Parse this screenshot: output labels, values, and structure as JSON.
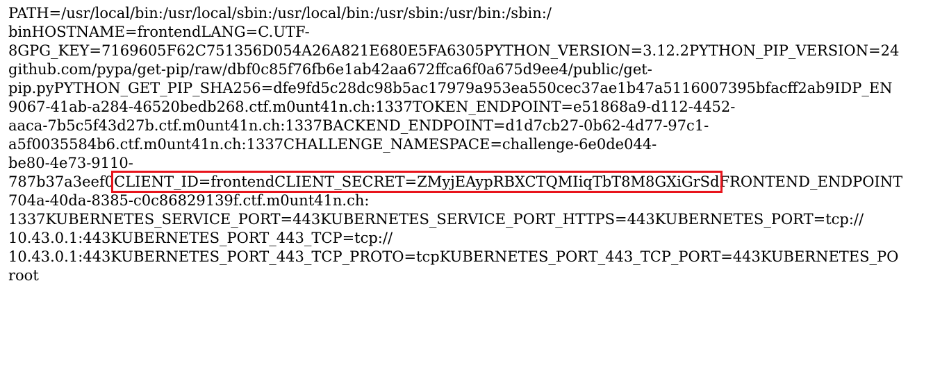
{
  "env_output": {
    "lines": [
      "PATH=/usr/local/bin:/usr/local/sbin:/usr/local/bin:/usr/sbin:/usr/bin:/sbin:/",
      "binHOSTNAME=frontendLANG=C.UTF-",
      "8GPG_KEY=7169605F62C751356D054A26A821E680E5FA6305PYTHON_VERSION=3.12.2PYTHON_PIP_VERSION=24",
      "github.com/pypa/get-pip/raw/dbf0c85f76fb6e1ab42aa672ffca6f0a675d9ee4/public/get-",
      "pip.pyPYTHON_GET_PIP_SHA256=dfe9fd5c28dc98b5ac17979a953ea550cec37ae1b47a5116007395bfacff2ab9IDP_EN",
      "9067-41ab-a284-46520bedb268.ctf.m0unt41n.ch:1337TOKEN_ENDPOINT=e51868a9-d112-4452-",
      "aaca-7b5c5f43d27b.ctf.m0unt41n.ch:1337BACKEND_ENDPOINT=d1d7cb27-0b62-4d77-97c1-",
      "a5f0035584b6.ctf.m0unt41n.ch:1337CHALLENGE_NAMESPACE=challenge-6e0de044-",
      "be80-4e73-9110-"
    ],
    "highlight_line": {
      "prefix": "787b37a3eef0",
      "highlighted": "CLIENT_ID=frontendCLIENT_SECRET=ZMyjEAypRBXCTQMIiqTbT8M8GXiGrSd",
      "suffix": "FRONTEND_ENDPOINT"
    },
    "lines_after": [
      "704a-40da-8385-c0c86829139f.ctf.m0unt41n.ch:",
      "1337KUBERNETES_SERVICE_PORT=443KUBERNETES_SERVICE_PORT_HTTPS=443KUBERNETES_PORT=tcp://",
      "10.43.0.1:443KUBERNETES_PORT_443_TCP=tcp://",
      "10.43.0.1:443KUBERNETES_PORT_443_TCP_PROTO=tcpKUBERNETES_PORT_443_TCP_PORT=443KUBERNETES_PO",
      "root"
    ]
  },
  "colors": {
    "highlight_border": "#e8141c",
    "text": "#000000",
    "background": "#ffffff"
  }
}
